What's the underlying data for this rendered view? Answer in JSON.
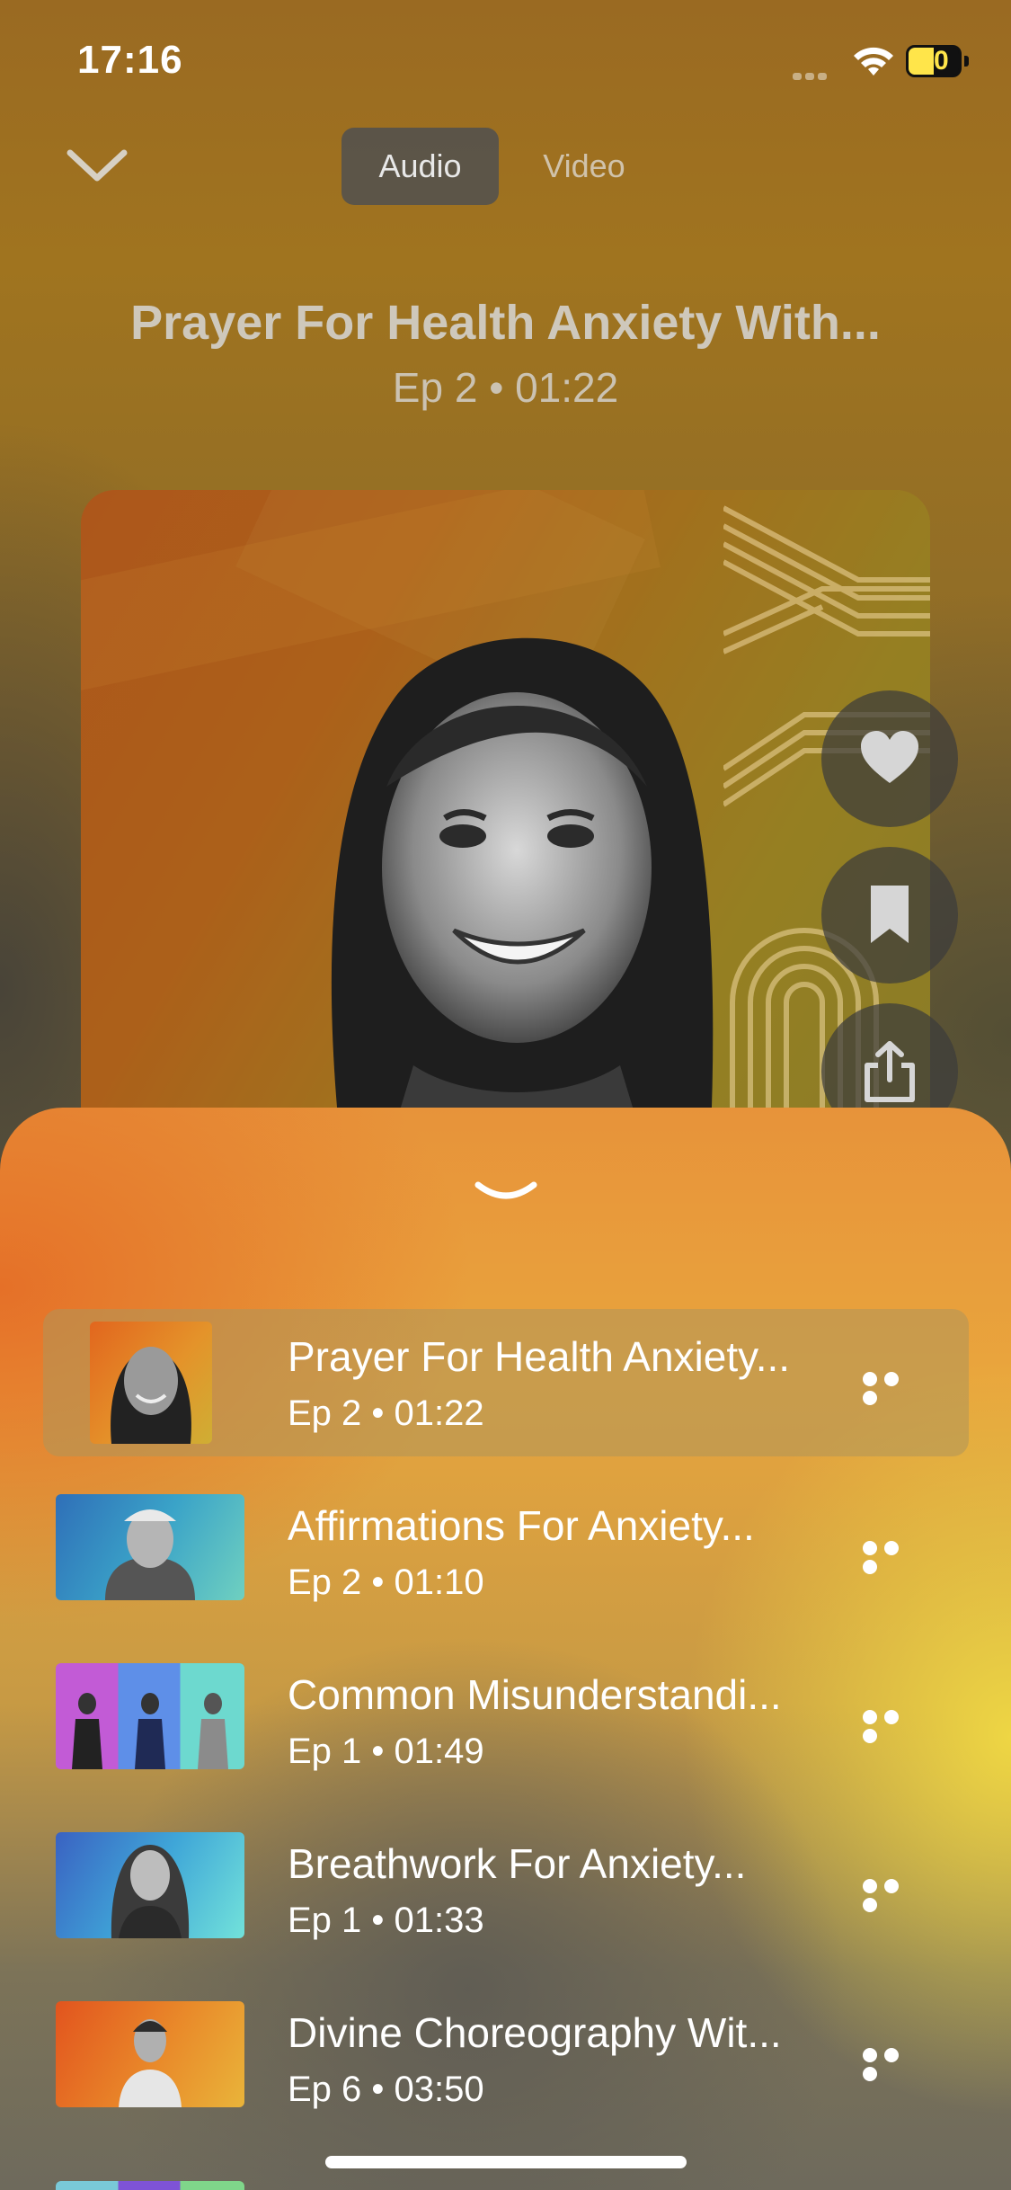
{
  "status_bar": {
    "time": "17:16",
    "battery": "50"
  },
  "header": {
    "tabs": [
      "Audio",
      "Video"
    ],
    "selected_tab": "Audio"
  },
  "now_playing": {
    "title": "Prayer For Health Anxiety With...",
    "subtitle": "Ep 2 • 01:22"
  },
  "actions": {
    "like_icon": "heart-icon",
    "save_icon": "bookmark-icon",
    "share_icon": "share-icon"
  },
  "queue": [
    {
      "title": "Prayer For Health Anxiety...",
      "subtitle": "Ep 2 • 01:22",
      "active": true
    },
    {
      "title": "Affirmations For Anxiety...",
      "subtitle": "Ep 2 • 01:10",
      "active": false
    },
    {
      "title": "Common Misunderstandi...",
      "subtitle": "Ep 1 • 01:49",
      "active": false
    },
    {
      "title": "Breathwork For Anxiety...",
      "subtitle": "Ep 1 • 01:33",
      "active": false
    },
    {
      "title": "Divine Choreography Wit...",
      "subtitle": "Ep 6 • 03:50",
      "active": false
    }
  ]
}
